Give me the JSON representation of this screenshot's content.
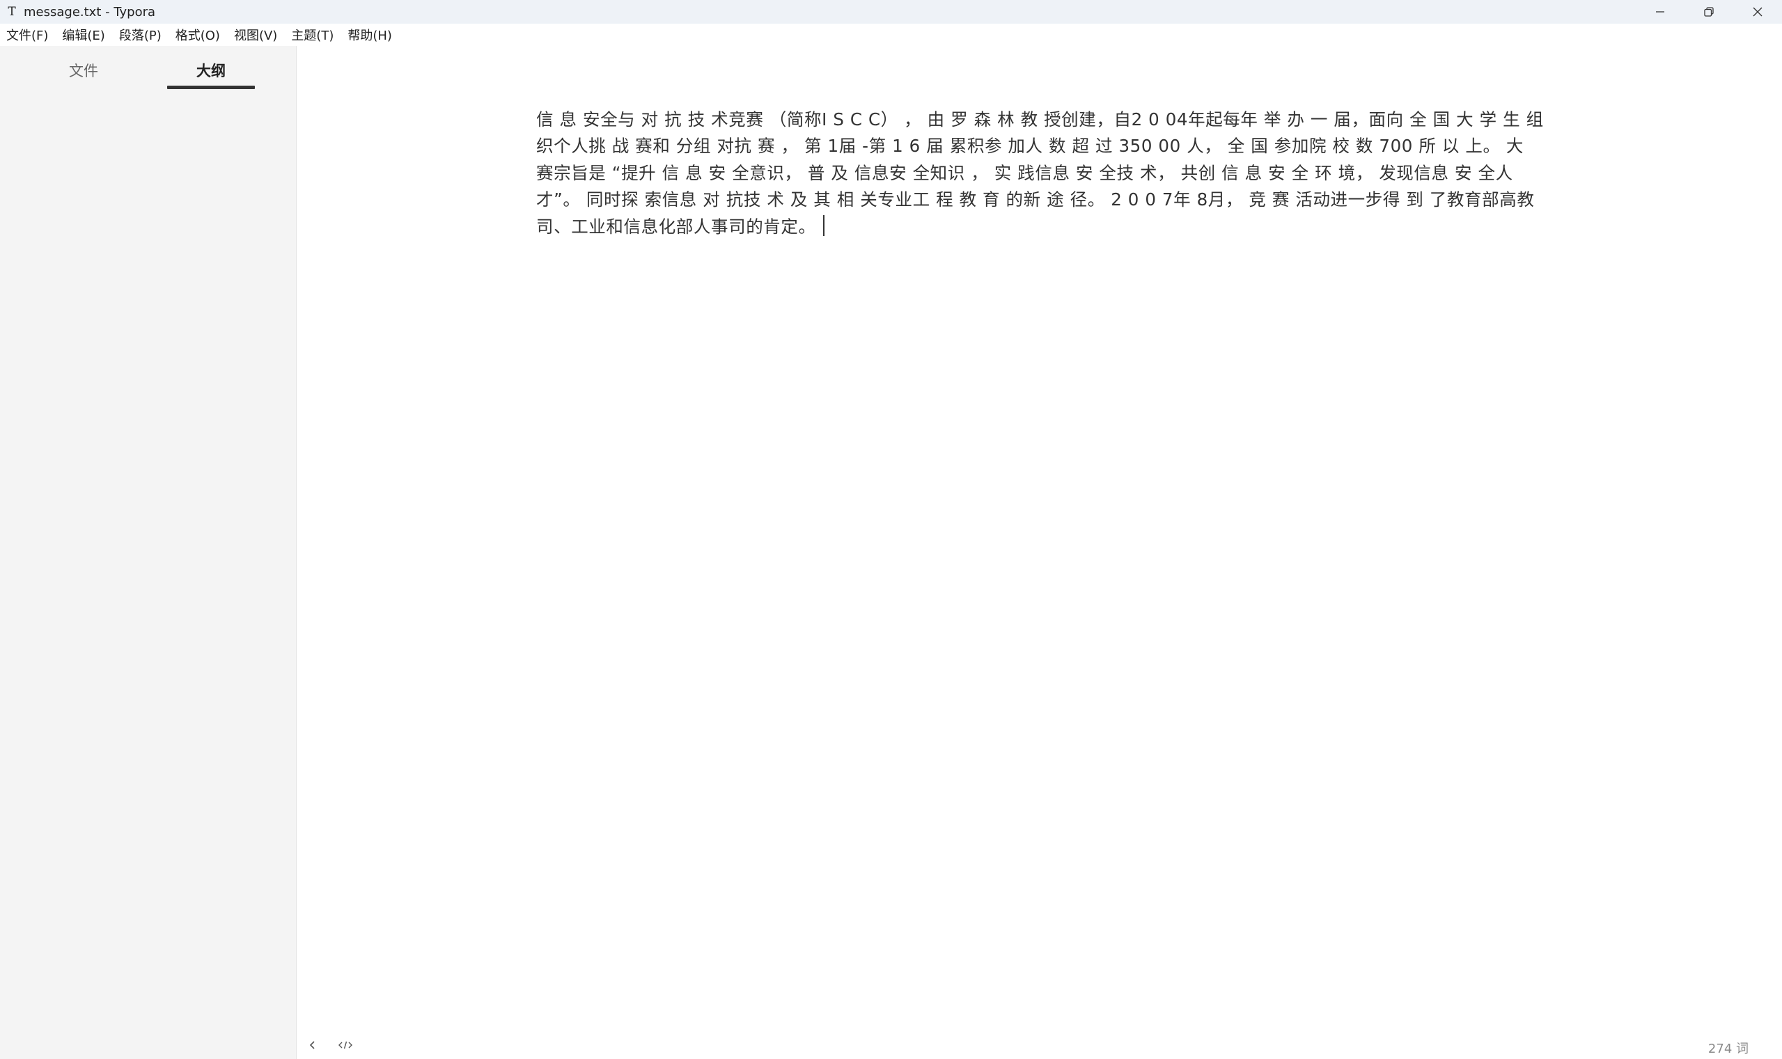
{
  "window": {
    "title": "message.txt - Typora",
    "app_icon_glyph": "T",
    "controls": [
      "minimize-icon",
      "restore-icon",
      "close-icon"
    ]
  },
  "menubar": {
    "items": [
      {
        "label": "文件(F)"
      },
      {
        "label": "编辑(E)"
      },
      {
        "label": "段落(P)"
      },
      {
        "label": "格式(O)"
      },
      {
        "label": "视图(V)"
      },
      {
        "label": "主题(T)"
      },
      {
        "label": "帮助(H)"
      }
    ]
  },
  "sidebar": {
    "tabs": [
      {
        "label": "文件",
        "active": false
      },
      {
        "label": "大纲",
        "active": true
      }
    ]
  },
  "editor": {
    "paragraph": "信 息 安全与 对 抗  技 术竞赛 （简称I  S C C）  ，  由 罗 森  林 教 授创建，自2  0 04年起每年 举  办 一 届，面向 全 国  大 学 生 组织个人挑  战 赛和 分组 对抗 赛  ，  第 1届 -第 1  6 届 累积参 加人  数 超 过 350 00  人，  全 国 参加院 校  数 700 所 以 上。  大 赛宗旨是 “提升  信 息 安 全意识，  普  及 信息安 全知识  ，  实 践信息 安 全技  术，  共创 信 息 安  全 环 境，  发现信息  安 全人才”。 同时探 索信息 对 抗技 术  及 其 相 关专业工 程  教 育 的新 途 径。 2  0 0 7年 8月，  竞  赛 活动进一步得 到  了教育部高教司、工业和信息化部人事司的肯定。"
  },
  "footer": {
    "back_icon": "chevron-left-icon",
    "source_icon": "code-icon",
    "word_count": "274 词"
  }
}
